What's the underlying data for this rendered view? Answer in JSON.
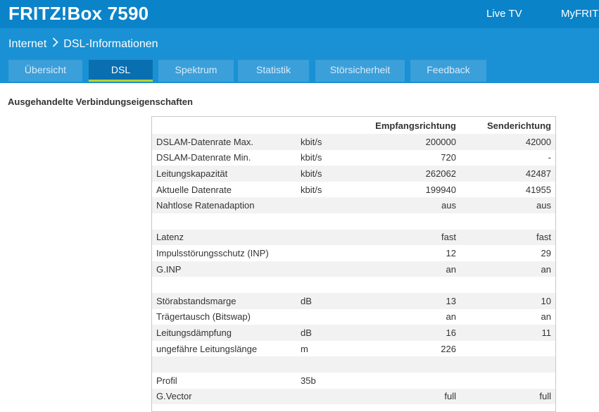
{
  "header": {
    "brand": "FRITZ!Box 7590",
    "links": {
      "livetv": "Live TV",
      "myfritz": "MyFRITZ!"
    }
  },
  "breadcrumb": {
    "parent": "Internet",
    "current": "DSL-Informationen"
  },
  "tabs": [
    {
      "label": "Übersicht",
      "active": false
    },
    {
      "label": "DSL",
      "active": true
    },
    {
      "label": "Spektrum",
      "active": false
    },
    {
      "label": "Statistik",
      "active": false
    },
    {
      "label": "Störsicherheit",
      "active": false
    },
    {
      "label": "Feedback",
      "active": false
    }
  ],
  "section_title": "Ausgehandelte Verbindungseigenschaften",
  "table": {
    "headers": [
      "",
      "",
      "Empfangsrichtung",
      "Senderichtung"
    ],
    "rows": [
      [
        "DSLAM-Datenrate Max.",
        "kbit/s",
        "200000",
        "42000"
      ],
      [
        "DSLAM-Datenrate Min.",
        "kbit/s",
        "720",
        "-"
      ],
      [
        "Leitungskapazität",
        "kbit/s",
        "262062",
        "42487"
      ],
      [
        "Aktuelle Datenrate",
        "kbit/s",
        "199940",
        "41955"
      ],
      [
        "Nahtlose Ratenadaption",
        "",
        "aus",
        "aus"
      ],
      [
        "",
        "",
        "",
        ""
      ],
      [
        "Latenz",
        "",
        "fast",
        "fast"
      ],
      [
        "Impulsstörungsschutz (INP)",
        "",
        "12",
        "29"
      ],
      [
        "G.INP",
        "",
        "an",
        "an"
      ],
      [
        "",
        "",
        "",
        ""
      ],
      [
        "Störabstandsmarge",
        "dB",
        "13",
        "10"
      ],
      [
        "Trägertausch (Bitswap)",
        "",
        "an",
        "an"
      ],
      [
        "Leitungsdämpfung",
        "dB",
        "16",
        "11"
      ],
      [
        "ungefähre Leitungslänge",
        "m",
        "226",
        ""
      ],
      [
        "",
        "",
        "",
        ""
      ],
      [
        "Profil",
        "35b",
        "",
        ""
      ],
      [
        "G.Vector",
        "",
        "full",
        "full"
      ],
      [
        "",
        "",
        "",
        ""
      ]
    ]
  },
  "colors": {
    "topbar": "#0a83c9",
    "subbar": "#1a91d4",
    "tab": "#3b9fda",
    "tab_active": "#0a6fb0",
    "tab_active_underline": "#b9d22c"
  }
}
